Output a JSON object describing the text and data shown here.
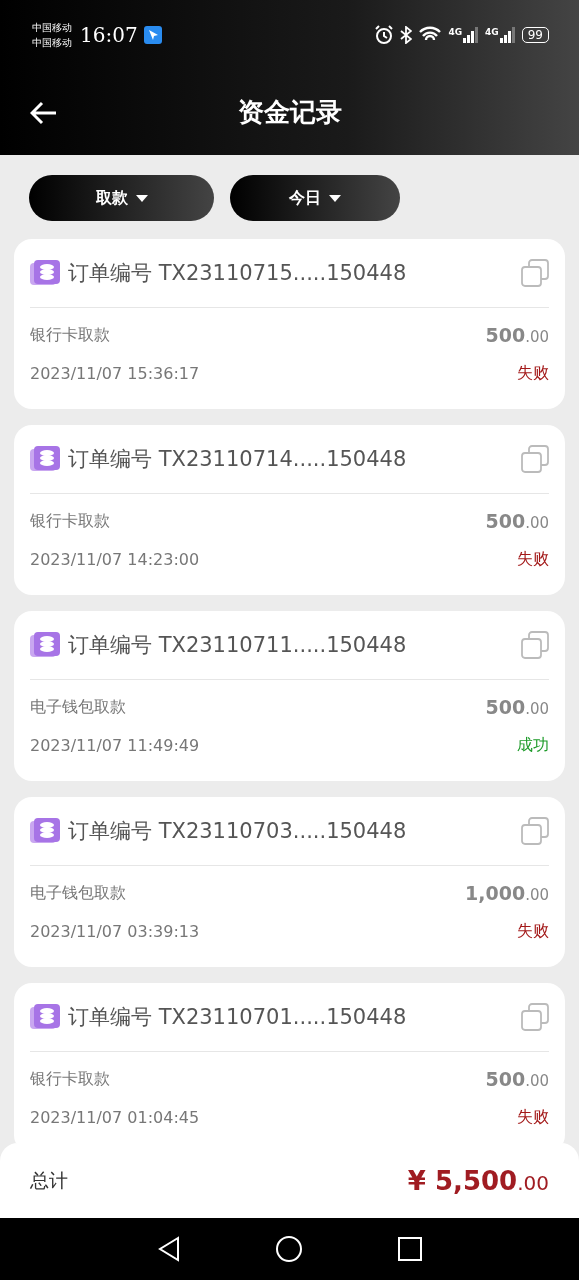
{
  "status_bar": {
    "carrier_1": "中国移动",
    "carrier_2": "中国移动",
    "time": "16:07",
    "battery": "99",
    "network_1": "4G",
    "network_2": "4G"
  },
  "header": {
    "title": "资金记录"
  },
  "filters": [
    {
      "label": "取款"
    },
    {
      "label": "今日"
    }
  ],
  "records": [
    {
      "order": "订单编号 TX23110715.....150448",
      "method": "银行卡取款",
      "amount": "500",
      "decimal": ".00",
      "time": "2023/11/07 15:36:17",
      "status": {
        "text": "失败",
        "kind": "failed"
      }
    },
    {
      "order": "订单编号 TX23110714.....150448",
      "method": "银行卡取款",
      "amount": "500",
      "decimal": ".00",
      "time": "2023/11/07 14:23:00",
      "status": {
        "text": "失败",
        "kind": "failed"
      }
    },
    {
      "order": "订单编号 TX23110711.....150448",
      "method": "电子钱包取款",
      "amount": "500",
      "decimal": ".00",
      "time": "2023/11/07 11:49:49",
      "status": {
        "text": "成功",
        "kind": "success"
      }
    },
    {
      "order": "订单编号 TX23110703.....150448",
      "method": "电子钱包取款",
      "amount": "1,000",
      "decimal": ".00",
      "time": "2023/11/07 03:39:13",
      "status": {
        "text": "失败",
        "kind": "failed"
      }
    },
    {
      "order": "订单编号 TX23110701.....150448",
      "method": "银行卡取款",
      "amount": "500",
      "decimal": ".00",
      "time": "2023/11/07 01:04:45",
      "status": {
        "text": "失败",
        "kind": "failed"
      }
    }
  ],
  "total": {
    "label": "总计",
    "currency": "¥",
    "amount": "5,500",
    "decimal": ".00"
  }
}
